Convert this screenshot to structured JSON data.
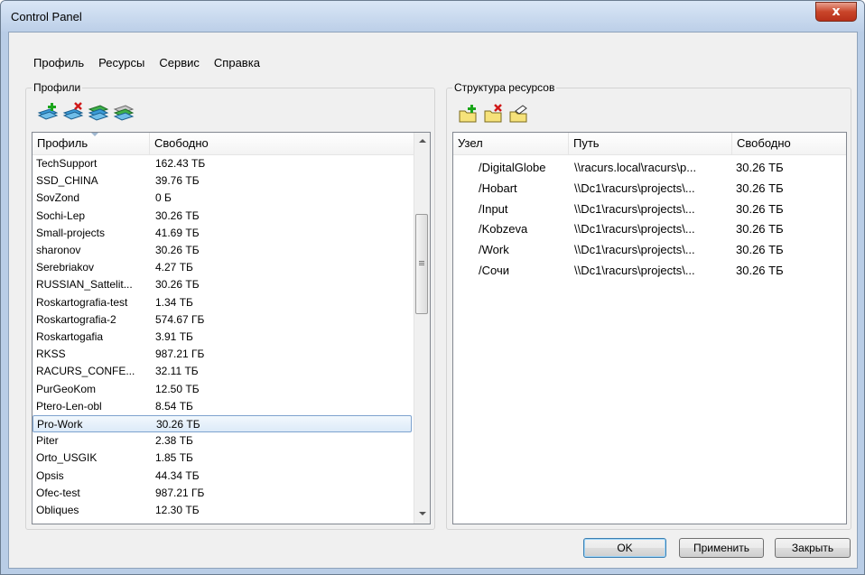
{
  "window": {
    "title": "Control Panel",
    "close_glyph": "x"
  },
  "menu": [
    "Профиль",
    "Ресурсы",
    "Сервис",
    "Справка"
  ],
  "profiles": {
    "group_label": "Профили",
    "toolbar": [
      "add-profile-icon",
      "delete-profile-icon",
      "edit-profile-icon",
      "copy-profile-icon"
    ],
    "columns": [
      "Профиль",
      "Свободно"
    ],
    "rows": [
      [
        "TechSupport",
        "162.43 ТБ"
      ],
      [
        "SSD_CHINA",
        "39.76 ТБ"
      ],
      [
        "SovZond",
        "0 Б"
      ],
      [
        "Sochi-Lep",
        "30.26 ТБ"
      ],
      [
        "Small-projects",
        "41.69 ТБ"
      ],
      [
        "sharonov",
        "30.26 ТБ"
      ],
      [
        "Serebriakov",
        "4.27 ТБ"
      ],
      [
        "RUSSIAN_Sattelit...",
        "30.26 ТБ"
      ],
      [
        "Roskartografia-test",
        "1.34 ТБ"
      ],
      [
        "Roskartografia-2",
        "574.67 ГБ"
      ],
      [
        "Roskartogafia",
        "3.91 ТБ"
      ],
      [
        "RKSS",
        "987.21 ГБ"
      ],
      [
        "RACURS_CONFE...",
        "32.11 ТБ"
      ],
      [
        "PurGeoKom",
        "12.50 ТБ"
      ],
      [
        "Ptero-Len-obl",
        "8.54 ТБ"
      ],
      [
        "Pro-Work",
        "30.26 ТБ"
      ],
      [
        "Piter",
        "2.38 ТБ"
      ],
      [
        "Orto_USGIK",
        "1.85 ТБ"
      ],
      [
        "Opsis",
        "44.34 ТБ"
      ],
      [
        "Ofec-test",
        "987.21 ГБ"
      ],
      [
        "Obliques",
        "12.30 ТБ"
      ]
    ],
    "selected_index": 15
  },
  "resources": {
    "group_label": "Структура ресурсов",
    "toolbar": [
      "add-folder-icon",
      "delete-folder-icon",
      "edit-folder-icon"
    ],
    "columns": [
      "Узел",
      "Путь",
      "Свободно"
    ],
    "rows": [
      [
        "/DigitalGlobe",
        "\\\\racurs.local\\racurs\\p...",
        "30.26 ТБ"
      ],
      [
        "/Hobart",
        "\\\\Dc1\\racurs\\projects\\...",
        "30.26 ТБ"
      ],
      [
        "/Input",
        "\\\\Dc1\\racurs\\projects\\...",
        "30.26 ТБ"
      ],
      [
        "/Kobzeva",
        "\\\\Dc1\\racurs\\projects\\...",
        "30.26 ТБ"
      ],
      [
        "/Work",
        "\\\\Dc1\\racurs\\projects\\...",
        "30.26 ТБ"
      ],
      [
        "/Сочи",
        "\\\\Dc1\\racurs\\projects\\...",
        "30.26 ТБ"
      ]
    ]
  },
  "buttons": {
    "ok": "OK",
    "apply": "Применить",
    "close": "Закрыть"
  }
}
